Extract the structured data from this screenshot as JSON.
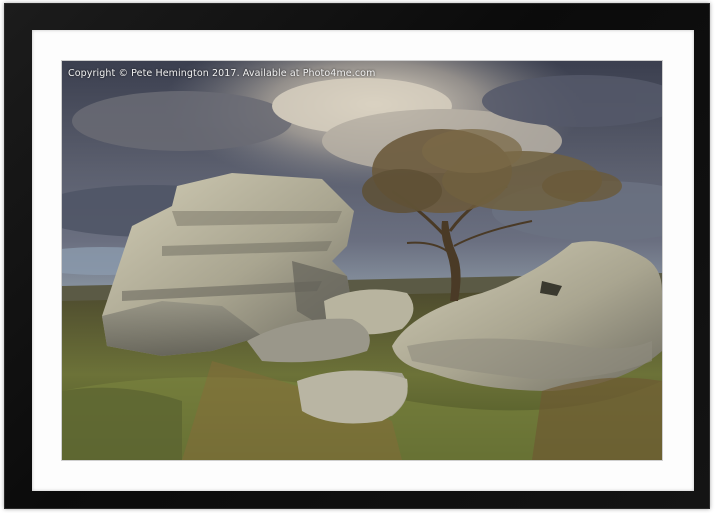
{
  "watermark": {
    "text": "Copyright  © Pete Hemington  2017. Available at Photo4me.com"
  },
  "colors": {
    "frame": "#111111",
    "mount": "#fdfdfd",
    "sky_dark": "#3e4252",
    "sky_light": "#c9c3b8",
    "rock": "#a8a596",
    "grass": "#6f7a3a"
  }
}
